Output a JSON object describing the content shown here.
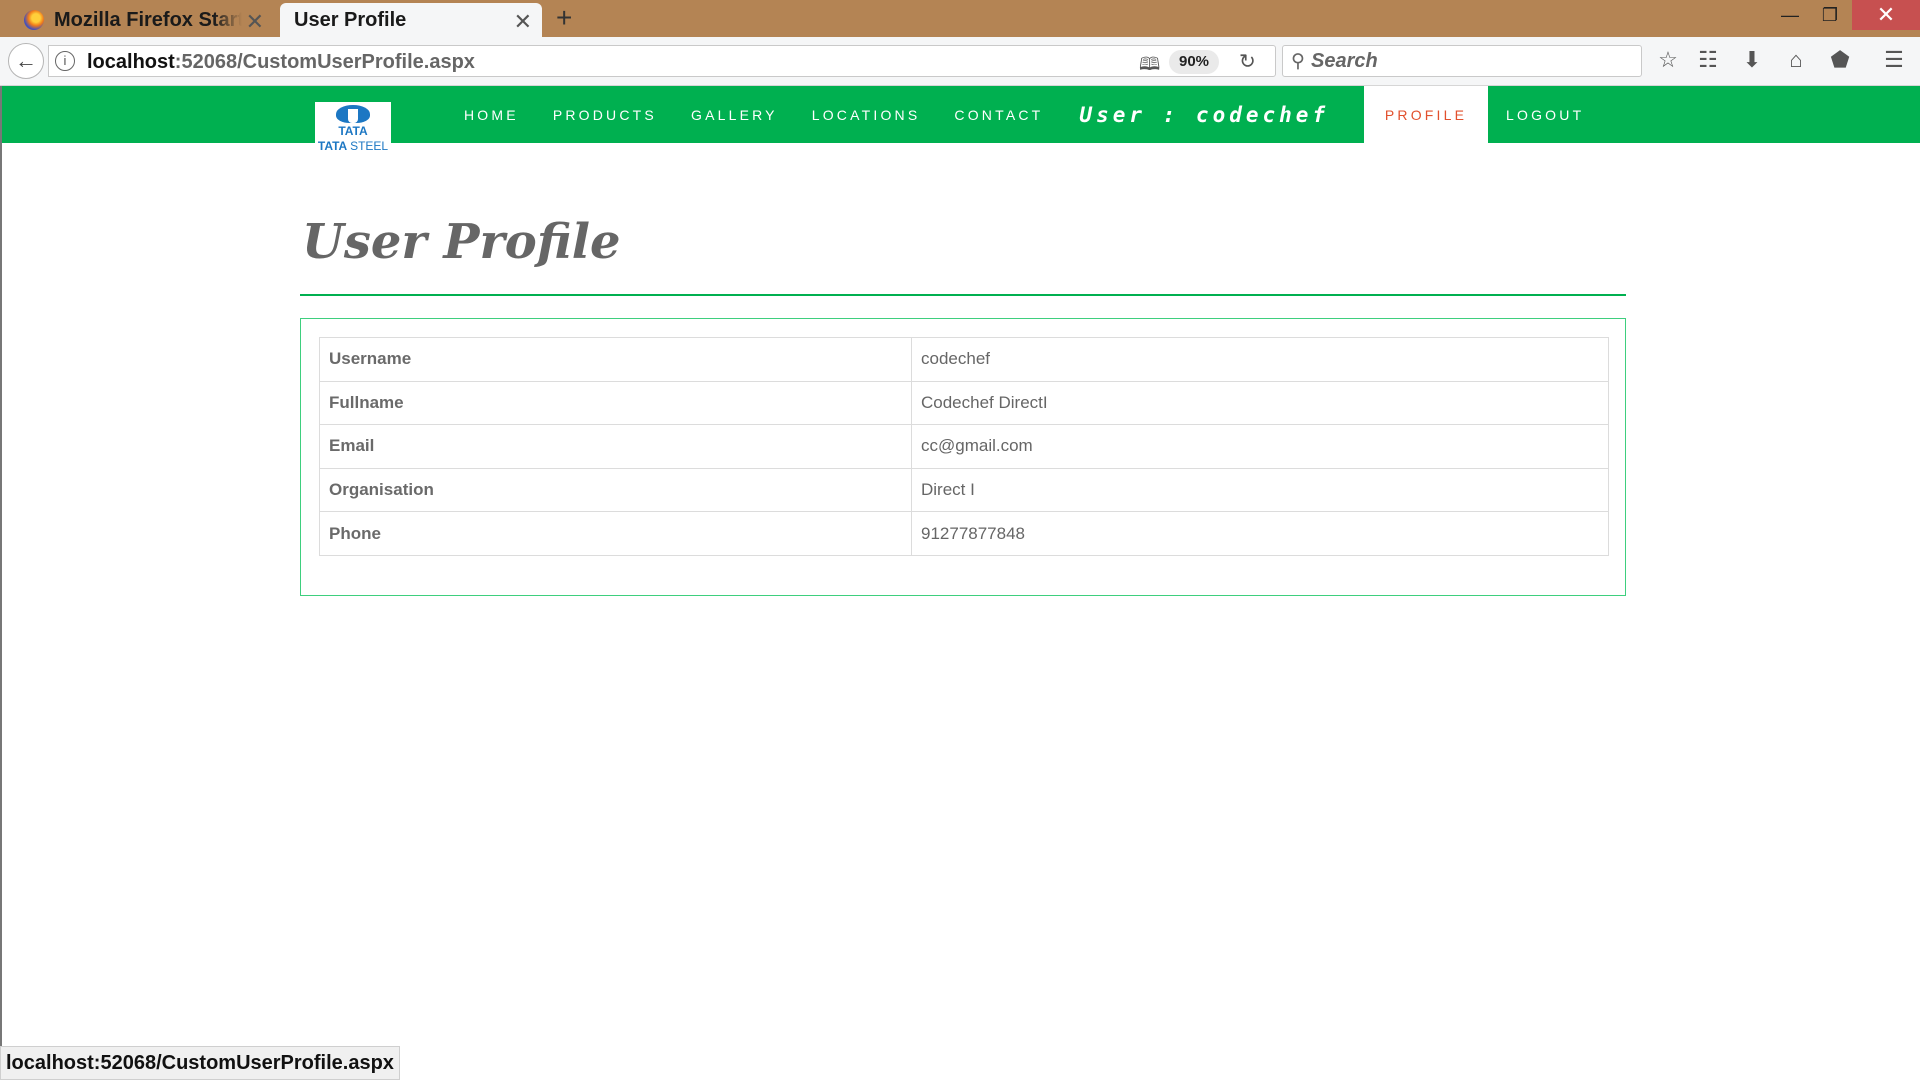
{
  "browser": {
    "tabs": [
      {
        "title": "Mozilla Firefox Start Page",
        "active": false
      },
      {
        "title": "User Profile",
        "active": true
      }
    ],
    "new_tab_glyph": "+",
    "close_glyph": "✕",
    "url_host": "localhost",
    "url_rest": ":52068/CustomUserProfile.aspx",
    "zoom": "90%",
    "search_placeholder": "Search",
    "status_url": "localhost:52068/CustomUserProfile.aspx",
    "icons": [
      "back-icon",
      "info-icon",
      "reader-view-icon",
      "reload-icon",
      "search-icon",
      "bookmark-star-icon",
      "bookmarks-library-icon",
      "download-icon",
      "home-icon",
      "pocket-icon",
      "menu-icon"
    ]
  },
  "site": {
    "brand_color": "#00b050",
    "logo": {
      "top": "TATA",
      "bottom_bold": "TATA",
      "bottom_light": "STEEL"
    },
    "menu": [
      "HOME",
      "PRODUCTS",
      "GALLERY",
      "LOCATIONS",
      "CONTACT"
    ],
    "user_label": "User : codechef",
    "active_item": "PROFILE",
    "logout": "LOGOUT",
    "active_color": "#e2502d"
  },
  "main": {
    "title": "User Profile",
    "rows": [
      {
        "label": "Username",
        "value": "codechef"
      },
      {
        "label": "Fullname",
        "value": "Codechef DirectI"
      },
      {
        "label": "Email",
        "value": "cc@gmail.com"
      },
      {
        "label": "Organisation",
        "value": "Direct I"
      },
      {
        "label": "Phone",
        "value": "91277877848"
      }
    ]
  }
}
